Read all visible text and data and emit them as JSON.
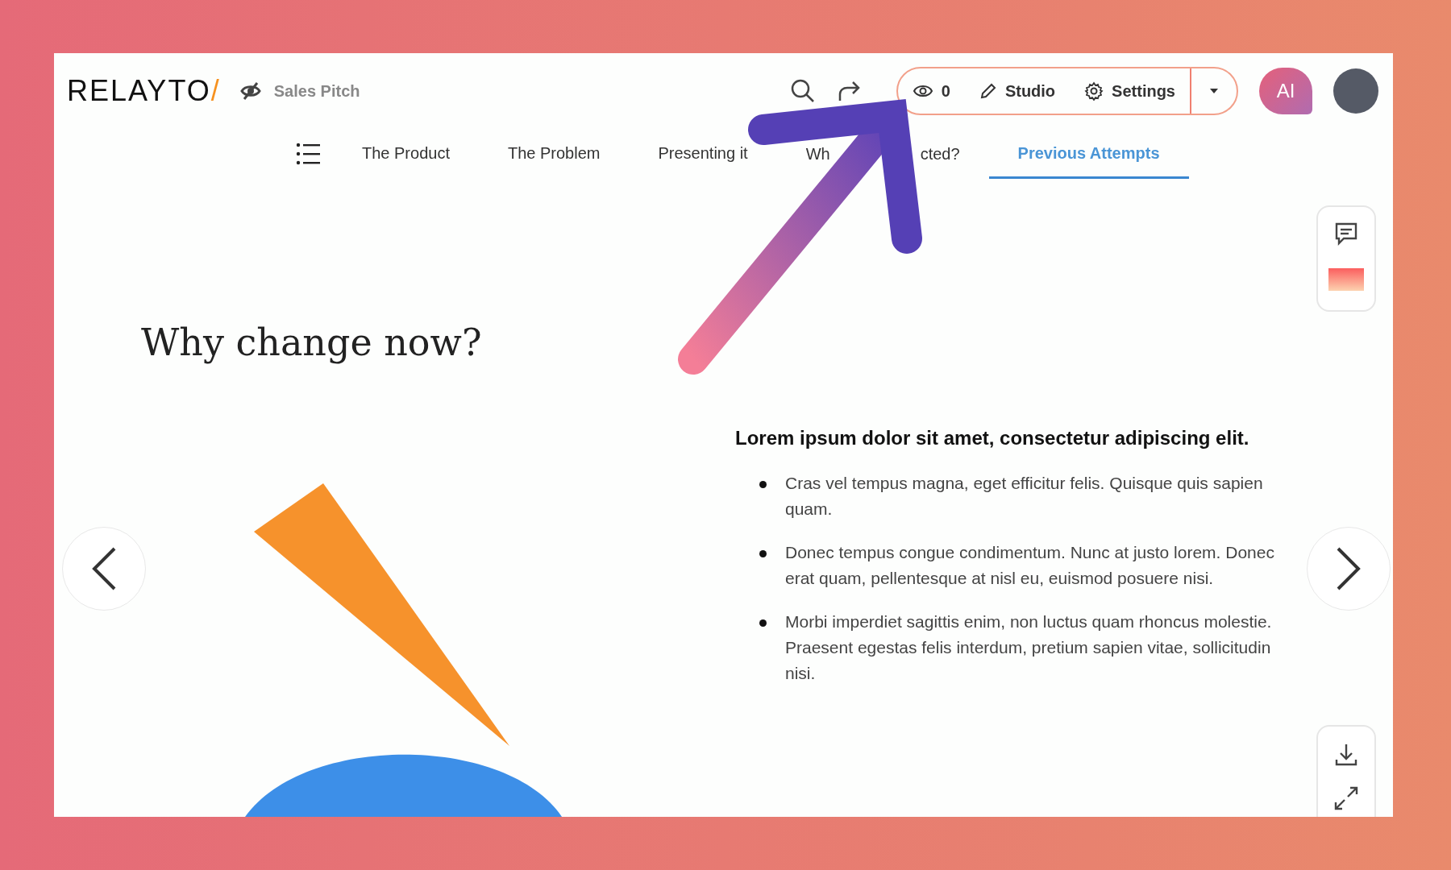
{
  "header": {
    "logo_text": "RELAYTO",
    "logo_mark": "/",
    "title": "Sales Pitch",
    "views": "0",
    "actions": [
      {
        "label": "Studio",
        "kind": "pencil"
      },
      {
        "label": "Settings",
        "kind": "gear"
      }
    ],
    "ai_label": "AI"
  },
  "tabs": [
    {
      "label_parts": [
        "The Product"
      ],
      "selected": false
    },
    {
      "label_parts": [
        "The Problem"
      ],
      "selected": false
    },
    {
      "label_parts": [
        "Presenting it"
      ],
      "selected": false
    },
    {
      "label_parts": [
        "Wh",
        "cted?"
      ],
      "selected": false
    },
    {
      "label_parts": [
        "Previous Attempts"
      ],
      "selected": true
    }
  ],
  "slide": {
    "heading": "Why change now?",
    "subheading": "Lorem ipsum dolor sit amet, consectetur adipiscing elit.",
    "bullets": [
      "Cras vel tempus magna, eget efficitur felis. Quisque quis sapien quam.",
      "Donec tempus congue condimentum. Nunc at justo lorem. Donec erat quam, pellentesque at nisl eu, euismod posuere nisi.",
      "Morbi imperdiet sagittis enim, non luctus quam rhoncus molestie. Praesent egestas felis interdum, pretium sapien vitae, sollicitudin nisi."
    ]
  }
}
